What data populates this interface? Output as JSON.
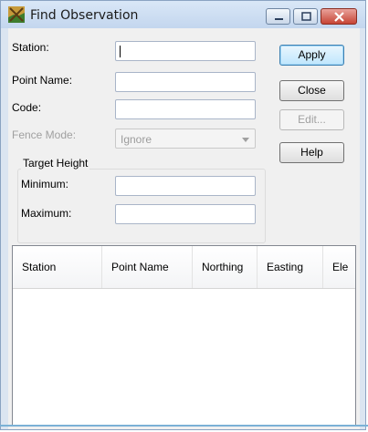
{
  "window": {
    "title": "Find Observation"
  },
  "form": {
    "station_label": "Station:",
    "station_value": "",
    "point_name_label": "Point Name:",
    "point_name_value": "",
    "code_label": "Code:",
    "code_value": "",
    "fence_mode_label": "Fence Mode:",
    "fence_mode_value": "Ignore",
    "target_height": {
      "title": "Target Height",
      "minimum_label": "Minimum:",
      "minimum_value": "",
      "maximum_label": "Maximum:",
      "maximum_value": ""
    }
  },
  "buttons": {
    "apply": "Apply",
    "close": "Close",
    "edit": "Edit...",
    "help": "Help"
  },
  "results": {
    "columns": [
      "Station",
      "Point Name",
      "Northing",
      "Easting",
      "Ele"
    ],
    "rows": []
  },
  "colors": {
    "default_button": "#bee6fd",
    "close_caption": "#c64434",
    "disabled_text": "#a0a0a0"
  },
  "icons": [
    "survey-app-icon",
    "minimize-icon",
    "maximize-icon",
    "close-icon",
    "dropdown-arrow-icon"
  ]
}
